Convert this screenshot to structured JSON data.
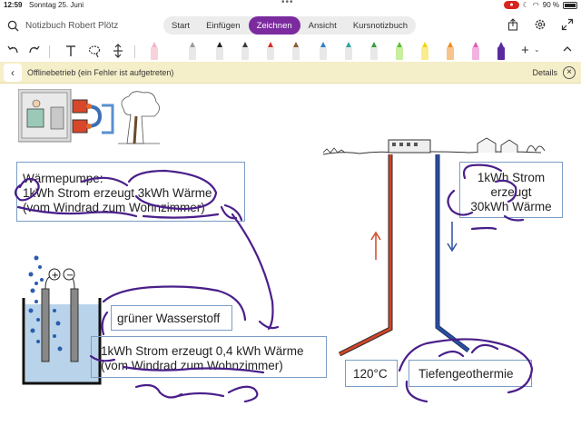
{
  "status_bar": {
    "time": "12:59",
    "date": "Sonntag 25. Juni",
    "dots": "•••",
    "battery": "90 %"
  },
  "top_bar": {
    "notebook_title": "Notizbuch Robert Plötz",
    "tabs": [
      {
        "label": "Start",
        "active": false
      },
      {
        "label": "Einfügen",
        "active": false
      },
      {
        "label": "Zeichnen",
        "active": true
      },
      {
        "label": "Ansicht",
        "active": false
      },
      {
        "label": "Kursnotizbuch",
        "active": false
      }
    ],
    "icons": [
      "share-icon",
      "settings-icon",
      "expand-icon"
    ]
  },
  "toolbar": {
    "tools": [
      "undo-icon",
      "redo-icon",
      "text-tool-icon",
      "lasso-icon",
      "insert-space-icon"
    ],
    "pen_colors": [
      "#f3b6c4",
      "#9a9a9a",
      "#222222",
      "#3b3b3b",
      "#d32f2f",
      "#8b5a2b",
      "#2f80c8",
      "#2ca6a4",
      "#3a9b3a",
      "#59c02e",
      "#f5d400",
      "#f08a1c",
      "#e25ab8",
      "#5b2aa0"
    ],
    "add_label": "+"
  },
  "banner": {
    "message": "Offlinebetrieb (ein Fehler ist aufgetreten)",
    "details": "Details",
    "close": "×"
  },
  "boxes": {
    "waermepumpe": "Wärmepumpe:\n1kWh Strom erzeugt 3kWh Wärme\n(vom Windrad zum Wohnzimmer)",
    "wasserstoff_label": "grüner Wasserstoff",
    "wasserstoff_text": "1kWh Strom erzeugt 0,4 kWh Wärme\n(vom Windrad zum Wohnzimmer)",
    "geothermie_text": "1kWh Strom\nerzeugt\n30kWh Wärme",
    "temperature": "120°C",
    "tiefengeothermie": "Tiefengeothermie"
  },
  "colors": {
    "accent": "#7b2b9e",
    "ink_purple": "#4a1f8a",
    "pipe_red": "#d0452a",
    "pipe_blue": "#2a4ea0"
  }
}
